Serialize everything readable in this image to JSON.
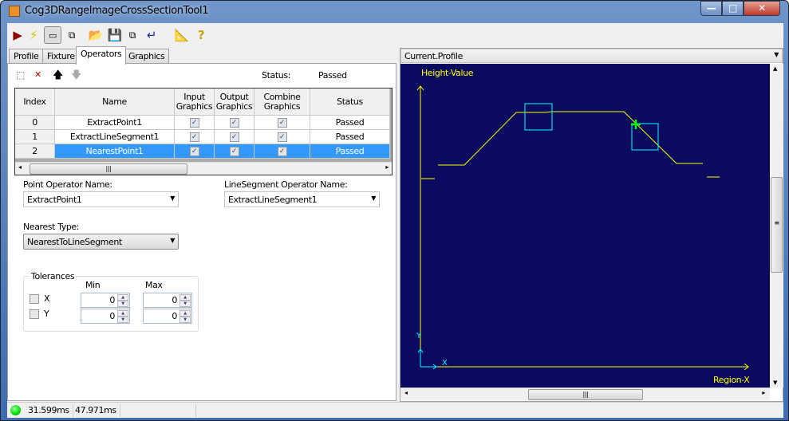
{
  "window": {
    "title": "Cog3DRangeImageCrossSectionTool1",
    "minimize": "—",
    "maximize": "□",
    "close": "✕"
  },
  "toolbar": {
    "icons": [
      "run-icon",
      "electric-icon",
      "show-grid-icon",
      "float-icon",
      "open-icon",
      "save-icon",
      "save-as-icon",
      "reset-icon",
      "ruler-icon",
      "help-icon"
    ]
  },
  "tabs": [
    {
      "label": "Profile"
    },
    {
      "label": "Fixture"
    },
    {
      "label": "Operators"
    },
    {
      "label": "Graphics"
    }
  ],
  "operators": {
    "status_label": "Status:",
    "status_value": "Passed",
    "columns": [
      "Index",
      "Name",
      "Input Graphics",
      "Output Graphics",
      "Combine Graphics",
      "Status"
    ],
    "rows": [
      {
        "index": "0",
        "name": "ExtractPoint1",
        "input": true,
        "output": true,
        "combine": true,
        "status": "Passed"
      },
      {
        "index": "1",
        "name": "ExtractLineSegment1",
        "input": true,
        "output": true,
        "combine": true,
        "status": "Passed"
      },
      {
        "index": "2",
        "name": "NearestPoint1",
        "input": true,
        "output": true,
        "combine": true,
        "status": "Passed",
        "selected": true
      }
    ],
    "point_operator_label": "Point Operator Name:",
    "point_operator_value": "ExtractPoint1",
    "line_operator_label": "LineSegment Operator Name:",
    "line_operator_value": "ExtractLineSegment1",
    "nearest_type_label": "Nearest Type:",
    "nearest_type_value": "NearestToLineSegment",
    "tolerances": {
      "label": "Tolerances",
      "min_label": "Min",
      "max_label": "Max",
      "x": {
        "label": "X",
        "checked": false,
        "min": "0",
        "max": "0"
      },
      "y": {
        "label": "Y",
        "checked": false,
        "min": "0",
        "max": "0"
      }
    }
  },
  "display": {
    "selector": "Current.Profile",
    "y_axis_label": "Height-Value",
    "x_axis_label": "Region-X",
    "x_marker": "X",
    "y_marker": "Y",
    "background": "#0a0a5e",
    "profile_color": "#ffff00",
    "region_color": "#00ffff",
    "point_color": "#00ff00"
  },
  "statusbar": {
    "indicator_color": "#00dd00",
    "time1": "31.599ms",
    "time2": "47.971ms"
  }
}
